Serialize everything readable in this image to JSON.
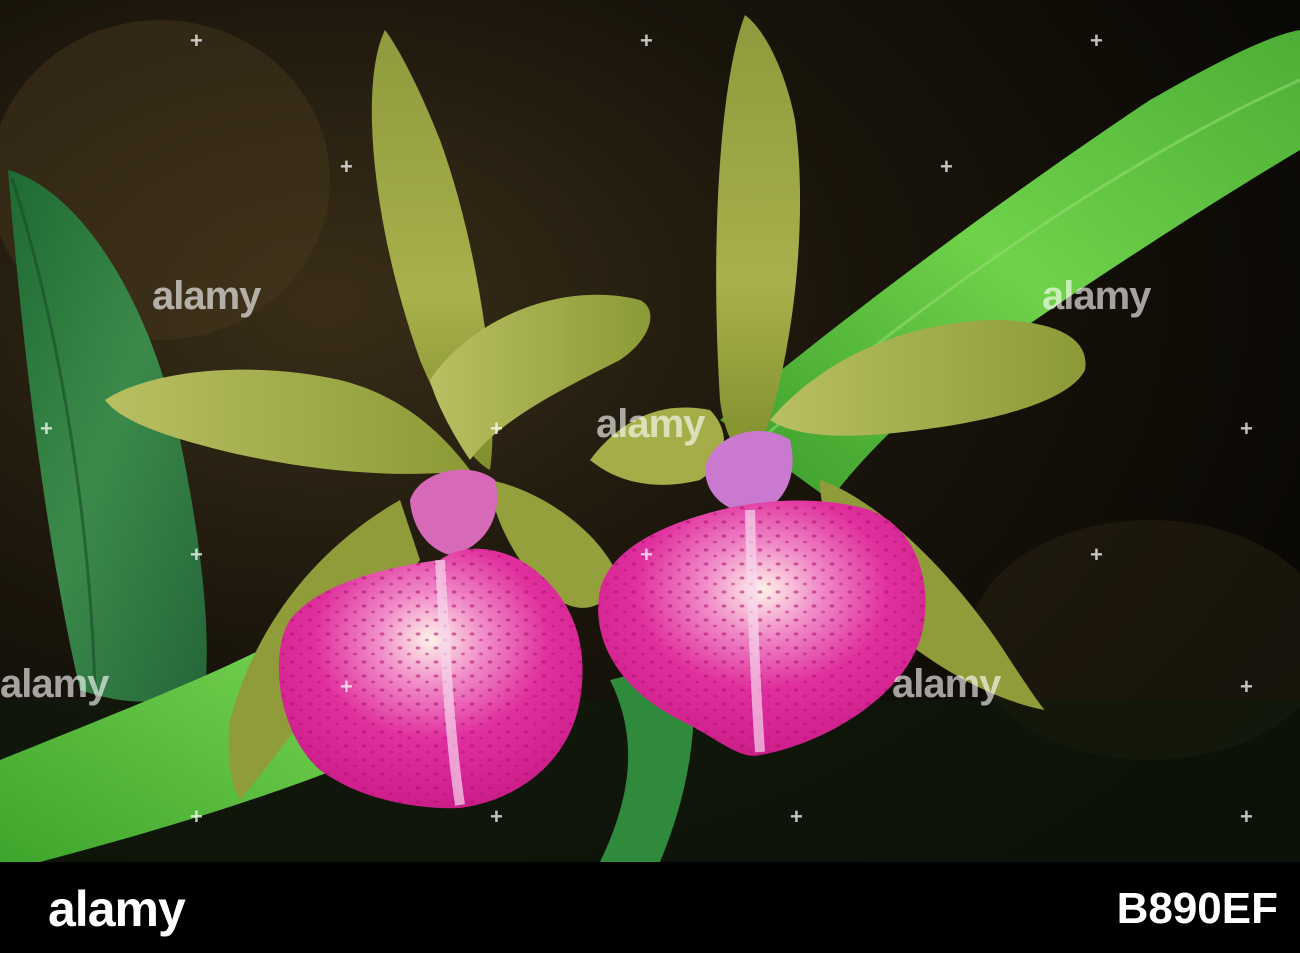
{
  "watermark": {
    "text": "alamy",
    "plus": "+"
  },
  "footer": {
    "logo": "alamy",
    "image_id": "B890EF"
  },
  "colors": {
    "background_dark": "#0e0b06",
    "leaf_green": "#5fc43a",
    "leaf_dark": "#2f7a3a",
    "sepal_olive": "#a3ab48",
    "lip_magenta": "#e0259a",
    "footer_black": "#000000"
  }
}
